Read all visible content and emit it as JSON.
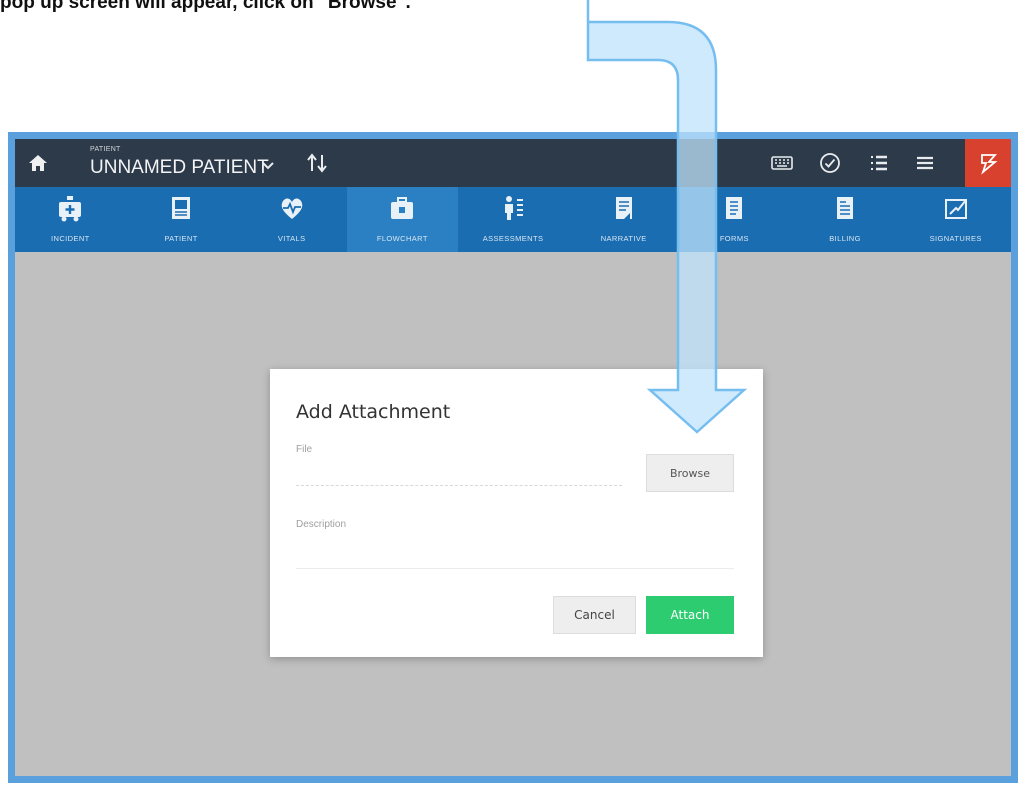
{
  "instruction": "pop up screen will appear, click on \"Browse\".",
  "topbar": {
    "patient_caption": "PATIENT",
    "patient_name": "UNNAMED PATIENT",
    "icons": [
      "home-icon",
      "chevron-down-icon",
      "sort-icon",
      "keyboard-icon",
      "check-circle-icon",
      "list-icon",
      "menu-icon",
      "flag-icon"
    ]
  },
  "tabs": [
    {
      "label": "INCIDENT",
      "icon": "ambulance-icon"
    },
    {
      "label": "PATIENT",
      "icon": "patient-card-icon"
    },
    {
      "label": "VITALS",
      "icon": "heartbeat-icon"
    },
    {
      "label": "FLOWCHART",
      "icon": "briefcase-icon",
      "active": true
    },
    {
      "label": "ASSESSMENTS",
      "icon": "body-assessment-icon"
    },
    {
      "label": "NARRATIVE",
      "icon": "document-icon"
    },
    {
      "label": "FORMS",
      "icon": "forms-icon"
    },
    {
      "label": "BILLING",
      "icon": "billing-icon"
    },
    {
      "label": "SIGNATURES",
      "icon": "signature-icon"
    }
  ],
  "modal": {
    "title": "Add Attachment",
    "file_label": "File",
    "browse_label": "Browse",
    "description_label": "Description",
    "cancel_label": "Cancel",
    "attach_label": "Attach"
  },
  "colors": {
    "frame": "#5aa0dd",
    "topbar": "#2d3a4a",
    "tabbar": "#1a6db1",
    "active_tab": "#2a80c3",
    "flag_button": "#d9412f",
    "attach_button": "#2ecc71",
    "arrow_fill": "#bfe3fb",
    "arrow_stroke": "#76bdf0"
  }
}
